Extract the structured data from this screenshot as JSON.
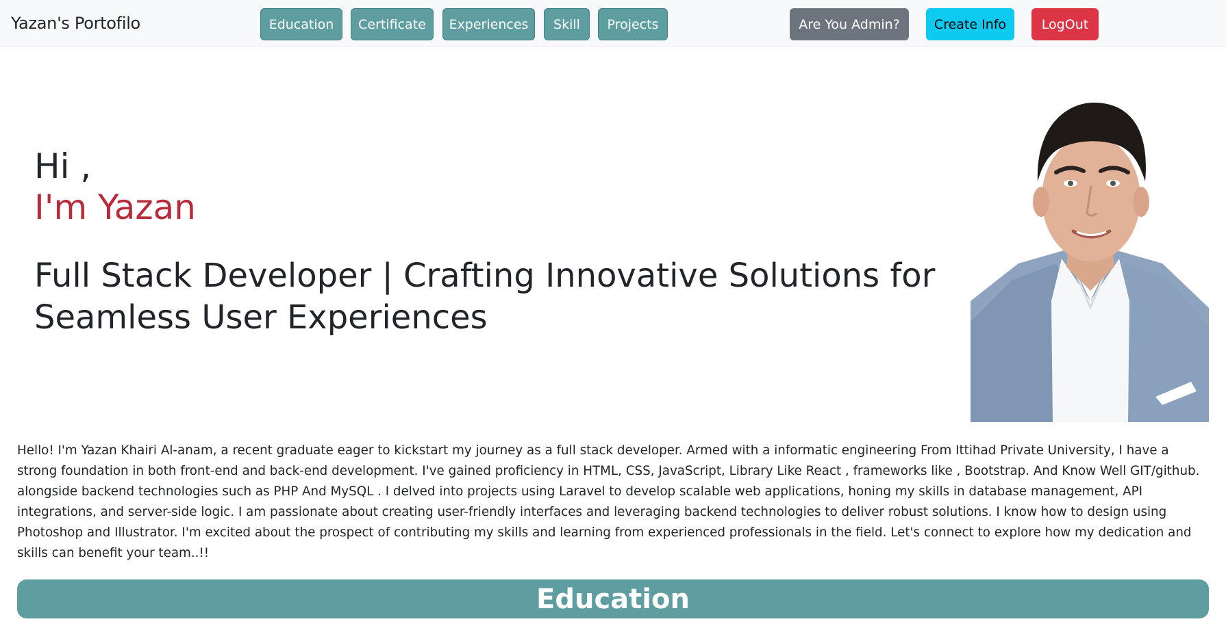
{
  "navbar": {
    "brand": "Yazan's Portofilo",
    "links": [
      "Education",
      "Certificate",
      "Experiences",
      "Skill",
      "Projects"
    ],
    "admin_label": "Are You Admin?",
    "create_label": "Create Info",
    "logout_label": "LogOut"
  },
  "hero": {
    "greeting": "Hi ,",
    "name": "I'm Yazan",
    "title": "Full Stack Developer | Crafting Innovative Solutions for Seamless User Experiences"
  },
  "bio": "Hello! I'm Yazan Khairi Al-anam, a recent graduate eager to kickstart my journey as a full stack developer. Armed with a informatic engineering From Ittihad Private University, I have a strong foundation in both front-end and back-end development. I've gained proficiency in HTML, CSS, JavaScript, Library Like React , frameworks like , Bootstrap. And Know Well GIT/github. alongside backend technologies such as PHP And MySQL . I delved into projects using Laravel to develop scalable web applications, honing my skills in database management, API integrations, and server-side logic. I am passionate about creating user-friendly interfaces and leveraging backend technologies to deliver robust solutions. I know how to design using Photoshop and Illustrator. I'm excited about the prospect of contributing my skills and learning from experienced professionals in the field. Let's connect to explore how my dedication and skills can benefit your team..!!",
  "section": {
    "title": "Education"
  },
  "colors": {
    "nav_button": "#5f9ea0",
    "accent_name": "#b82b3b",
    "admin": "#6c757d",
    "create": "#0dcaf0",
    "logout": "#dc3545"
  }
}
